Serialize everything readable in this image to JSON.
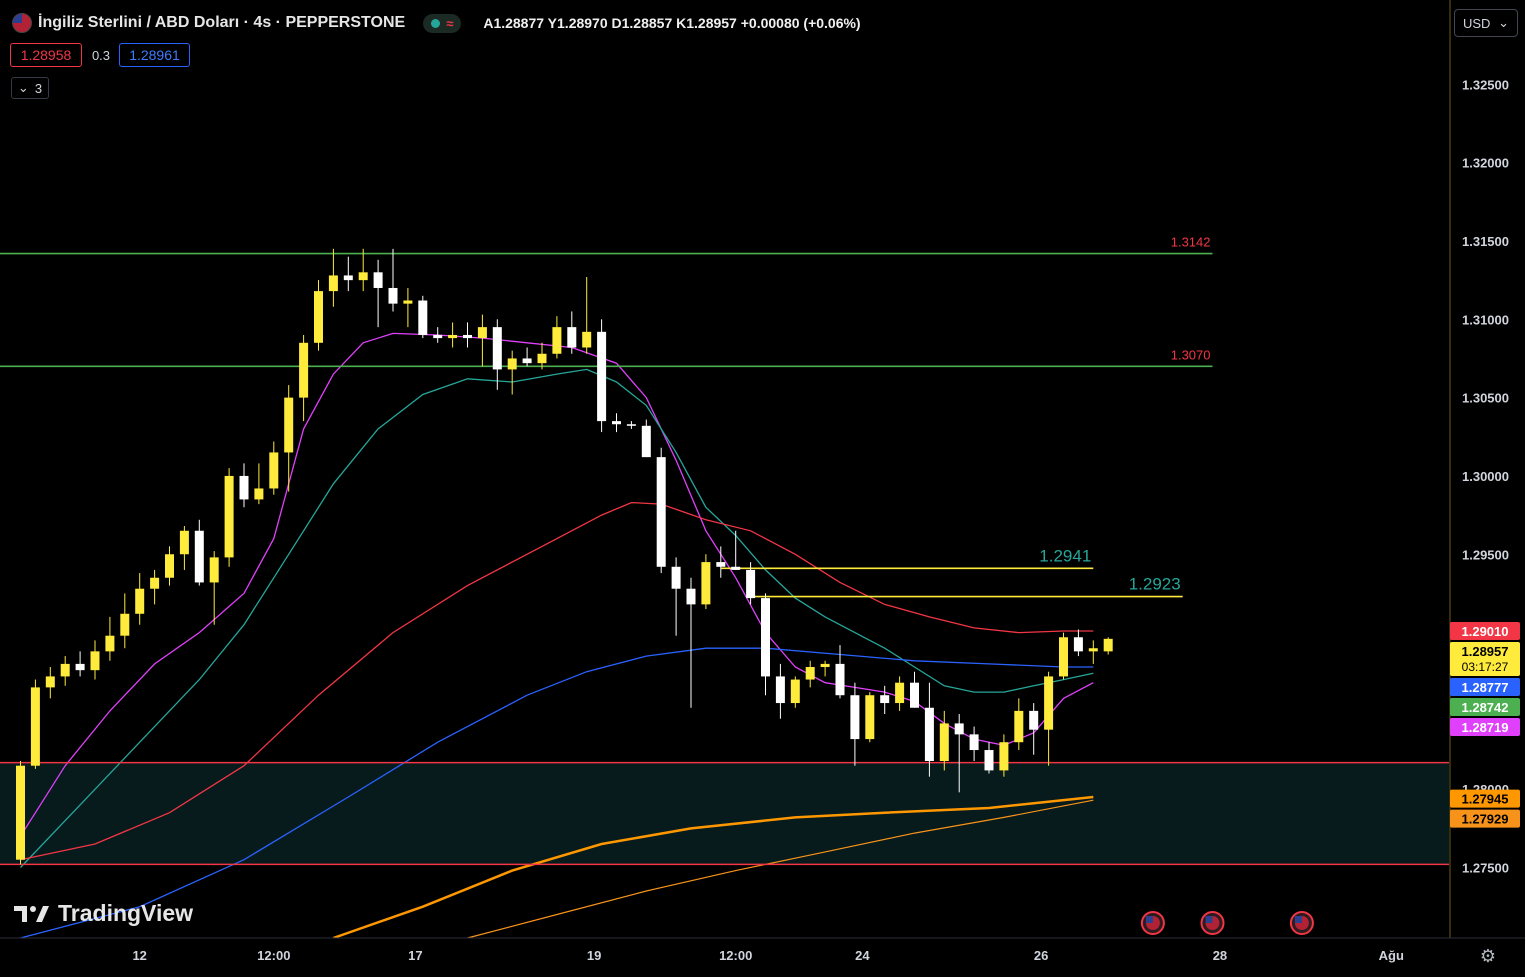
{
  "header": {
    "title": "İngiliz Sterlini / ABD Doları · 4s · PEPPERSTONE",
    "ohlc": "A1.28877  Y1.28970  D1.28857  K1.28957  +0.00080 (+0.06%)"
  },
  "trade": {
    "sell": "1.28958",
    "spread": "0.3",
    "buy": "1.28961"
  },
  "indicators_toggle": "3",
  "currency": "USD",
  "logo_text": "TradingView",
  "chart_data": {
    "type": "candlestick",
    "ylim": [
      1.2705,
      1.3293
    ],
    "x_tick_labels": [
      {
        "label": "12",
        "index": 8
      },
      {
        "label": "12:00",
        "index": 17
      },
      {
        "label": "17",
        "index": 26.5
      },
      {
        "label": "19",
        "index": 38.5
      },
      {
        "label": "12:00",
        "index": 48
      },
      {
        "label": "24",
        "index": 56.5
      },
      {
        "label": "26",
        "index": 68.5
      },
      {
        "label": "28",
        "index": 80.5
      },
      {
        "label": "Ağu",
        "index": 92
      }
    ],
    "y_tick_labels": [
      "1.32500",
      "1.32000",
      "1.31500",
      "1.31000",
      "1.30500",
      "1.30000",
      "1.29500",
      "1.28000",
      "1.27500"
    ],
    "candles": [
      {
        "o": 1.2755,
        "h": 1.2818,
        "l": 1.2752,
        "c": 1.2815
      },
      {
        "o": 1.2815,
        "h": 1.287,
        "l": 1.2813,
        "c": 1.2865
      },
      {
        "o": 1.2865,
        "h": 1.2878,
        "l": 1.2858,
        "c": 1.2872
      },
      {
        "o": 1.2872,
        "h": 1.2885,
        "l": 1.2866,
        "c": 1.288
      },
      {
        "o": 1.288,
        "h": 1.2888,
        "l": 1.2872,
        "c": 1.2876
      },
      {
        "o": 1.2876,
        "h": 1.2895,
        "l": 1.287,
        "c": 1.2888
      },
      {
        "o": 1.2888,
        "h": 1.291,
        "l": 1.2882,
        "c": 1.2898
      },
      {
        "o": 1.2898,
        "h": 1.2925,
        "l": 1.289,
        "c": 1.2912
      },
      {
        "o": 1.2912,
        "h": 1.2938,
        "l": 1.2905,
        "c": 1.2928
      },
      {
        "o": 1.2928,
        "h": 1.294,
        "l": 1.2918,
        "c": 1.2935
      },
      {
        "o": 1.2935,
        "h": 1.2955,
        "l": 1.293,
        "c": 1.295
      },
      {
        "o": 1.295,
        "h": 1.2968,
        "l": 1.294,
        "c": 1.2965
      },
      {
        "o": 1.2965,
        "h": 1.2972,
        "l": 1.293,
        "c": 1.2932
      },
      {
        "o": 1.2932,
        "h": 1.2952,
        "l": 1.2905,
        "c": 1.2948
      },
      {
        "o": 1.2948,
        "h": 1.3005,
        "l": 1.2942,
        "c": 1.3
      },
      {
        "o": 1.3,
        "h": 1.3008,
        "l": 1.298,
        "c": 1.2985
      },
      {
        "o": 1.2985,
        "h": 1.3008,
        "l": 1.2982,
        "c": 1.2992
      },
      {
        "o": 1.2992,
        "h": 1.3022,
        "l": 1.2988,
        "c": 1.3015
      },
      {
        "o": 1.3015,
        "h": 1.3058,
        "l": 1.299,
        "c": 1.305
      },
      {
        "o": 1.305,
        "h": 1.309,
        "l": 1.3035,
        "c": 1.3085
      },
      {
        "o": 1.3085,
        "h": 1.3125,
        "l": 1.308,
        "c": 1.3118
      },
      {
        "o": 1.3118,
        "h": 1.3145,
        "l": 1.3108,
        "c": 1.3128
      },
      {
        "o": 1.3128,
        "h": 1.314,
        "l": 1.3118,
        "c": 1.3125
      },
      {
        "o": 1.3125,
        "h": 1.3145,
        "l": 1.3118,
        "c": 1.313
      },
      {
        "o": 1.313,
        "h": 1.3138,
        "l": 1.3095,
        "c": 1.312
      },
      {
        "o": 1.312,
        "h": 1.3145,
        "l": 1.3105,
        "c": 1.311
      },
      {
        "o": 1.311,
        "h": 1.312,
        "l": 1.3095,
        "c": 1.3112
      },
      {
        "o": 1.3112,
        "h": 1.3115,
        "l": 1.3088,
        "c": 1.309
      },
      {
        "o": 1.309,
        "h": 1.3095,
        "l": 1.3085,
        "c": 1.3088
      },
      {
        "o": 1.3088,
        "h": 1.3098,
        "l": 1.3082,
        "c": 1.309
      },
      {
        "o": 1.309,
        "h": 1.3098,
        "l": 1.3082,
        "c": 1.3088
      },
      {
        "o": 1.3088,
        "h": 1.3103,
        "l": 1.307,
        "c": 1.3095
      },
      {
        "o": 1.3095,
        "h": 1.31,
        "l": 1.3055,
        "c": 1.3068
      },
      {
        "o": 1.3068,
        "h": 1.308,
        "l": 1.3052,
        "c": 1.3075
      },
      {
        "o": 1.3075,
        "h": 1.3082,
        "l": 1.307,
        "c": 1.3072
      },
      {
        "o": 1.3072,
        "h": 1.3085,
        "l": 1.3068,
        "c": 1.3078
      },
      {
        "o": 1.3078,
        "h": 1.3102,
        "l": 1.3075,
        "c": 1.3095
      },
      {
        "o": 1.3095,
        "h": 1.3105,
        "l": 1.3078,
        "c": 1.3082
      },
      {
        "o": 1.3082,
        "h": 1.3127,
        "l": 1.3078,
        "c": 1.3092
      },
      {
        "o": 1.3092,
        "h": 1.31,
        "l": 1.3028,
        "c": 1.3035
      },
      {
        "o": 1.3035,
        "h": 1.304,
        "l": 1.3028,
        "c": 1.3033
      },
      {
        "o": 1.3033,
        "h": 1.3035,
        "l": 1.303,
        "c": 1.3032
      },
      {
        "o": 1.3032,
        "h": 1.3036,
        "l": 1.302,
        "c": 1.3012
      },
      {
        "o": 1.3012,
        "h": 1.3018,
        "l": 1.2938,
        "c": 1.2942
      },
      {
        "o": 1.2942,
        "h": 1.2948,
        "l": 1.2898,
        "c": 1.2928
      },
      {
        "o": 1.2928,
        "h": 1.2935,
        "l": 1.2852,
        "c": 1.2918
      },
      {
        "o": 1.2918,
        "h": 1.295,
        "l": 1.2915,
        "c": 1.2945
      },
      {
        "o": 1.2945,
        "h": 1.2955,
        "l": 1.2935,
        "c": 1.2942
      },
      {
        "o": 1.2942,
        "h": 1.2965,
        "l": 1.294,
        "c": 1.294
      },
      {
        "o": 1.294,
        "h": 1.2945,
        "l": 1.2918,
        "c": 1.2922
      },
      {
        "o": 1.2922,
        "h": 1.2925,
        "l": 1.286,
        "c": 1.2872
      },
      {
        "o": 1.2872,
        "h": 1.288,
        "l": 1.2845,
        "c": 1.2855
      },
      {
        "o": 1.2855,
        "h": 1.2872,
        "l": 1.2852,
        "c": 1.287
      },
      {
        "o": 1.287,
        "h": 1.2882,
        "l": 1.2865,
        "c": 1.2878
      },
      {
        "o": 1.2878,
        "h": 1.2882,
        "l": 1.2872,
        "c": 1.288
      },
      {
        "o": 1.288,
        "h": 1.2892,
        "l": 1.2858,
        "c": 1.286
      },
      {
        "o": 1.286,
        "h": 1.2868,
        "l": 1.2815,
        "c": 1.2832
      },
      {
        "o": 1.2832,
        "h": 1.2862,
        "l": 1.283,
        "c": 1.286
      },
      {
        "o": 1.286,
        "h": 1.2866,
        "l": 1.2848,
        "c": 1.2855
      },
      {
        "o": 1.2855,
        "h": 1.2872,
        "l": 1.285,
        "c": 1.2868
      },
      {
        "o": 1.2868,
        "h": 1.2875,
        "l": 1.2852,
        "c": 1.2852
      },
      {
        "o": 1.2852,
        "h": 1.2868,
        "l": 1.2808,
        "c": 1.2818
      },
      {
        "o": 1.2818,
        "h": 1.285,
        "l": 1.2812,
        "c": 1.2842
      },
      {
        "o": 1.2842,
        "h": 1.2848,
        "l": 1.2798,
        "c": 1.2835
      },
      {
        "o": 1.2835,
        "h": 1.284,
        "l": 1.2818,
        "c": 1.2825
      },
      {
        "o": 1.2825,
        "h": 1.283,
        "l": 1.281,
        "c": 1.2812
      },
      {
        "o": 1.2812,
        "h": 1.2835,
        "l": 1.2808,
        "c": 1.283
      },
      {
        "o": 1.283,
        "h": 1.2858,
        "l": 1.2825,
        "c": 1.285
      },
      {
        "o": 1.285,
        "h": 1.2855,
        "l": 1.2822,
        "c": 1.2838
      },
      {
        "o": 1.2838,
        "h": 1.2875,
        "l": 1.2815,
        "c": 1.2872
      },
      {
        "o": 1.2872,
        "h": 1.29,
        "l": 1.287,
        "c": 1.2897
      },
      {
        "o": 1.2897,
        "h": 1.2902,
        "l": 1.2885,
        "c": 1.2888
      },
      {
        "o": 1.2888,
        "h": 1.2895,
        "l": 1.288,
        "c": 1.289
      },
      {
        "o": 1.2888,
        "h": 1.2897,
        "l": 1.2886,
        "c": 1.2896
      }
    ],
    "ma_lines": [
      {
        "color": "#e040fb",
        "points": [
          [
            0,
            1.277
          ],
          [
            3,
            1.2815
          ],
          [
            6,
            1.285
          ],
          [
            9,
            1.288
          ],
          [
            12,
            1.29
          ],
          [
            15,
            1.2925
          ],
          [
            17,
            1.296
          ],
          [
            19,
            1.303
          ],
          [
            21,
            1.3065
          ],
          [
            23,
            1.3085
          ],
          [
            25,
            1.3091
          ],
          [
            28,
            1.309
          ],
          [
            31,
            1.3088
          ],
          [
            34,
            1.3085
          ],
          [
            37,
            1.3082
          ],
          [
            40,
            1.3072
          ],
          [
            42,
            1.305
          ],
          [
            44,
            1.301
          ],
          [
            46,
            1.2965
          ],
          [
            48,
            1.2935
          ],
          [
            50,
            1.29
          ],
          [
            52,
            1.2878
          ],
          [
            54,
            1.2868
          ],
          [
            56,
            1.2865
          ],
          [
            58,
            1.2862
          ],
          [
            60,
            1.2856
          ],
          [
            62,
            1.2842
          ],
          [
            64,
            1.2832
          ],
          [
            66,
            1.2828
          ],
          [
            68,
            1.2836
          ],
          [
            70,
            1.2858
          ],
          [
            72,
            1.2868
          ]
        ]
      },
      {
        "color": "#26a69a",
        "points": [
          [
            0,
            1.275
          ],
          [
            4,
            1.279
          ],
          [
            8,
            1.283
          ],
          [
            12,
            1.287
          ],
          [
            15,
            1.2905
          ],
          [
            18,
            1.295
          ],
          [
            21,
            1.2995
          ],
          [
            24,
            1.303
          ],
          [
            27,
            1.3052
          ],
          [
            30,
            1.3062
          ],
          [
            33,
            1.306
          ],
          [
            36,
            1.3065
          ],
          [
            38,
            1.3068
          ],
          [
            40,
            1.306
          ],
          [
            42,
            1.3045
          ],
          [
            44,
            1.3015
          ],
          [
            46,
            1.298
          ],
          [
            48,
            1.2962
          ],
          [
            50,
            1.294
          ],
          [
            52,
            1.2922
          ],
          [
            54,
            1.291
          ],
          [
            56,
            1.29
          ],
          [
            58,
            1.289
          ],
          [
            60,
            1.2878
          ],
          [
            62,
            1.2866
          ],
          [
            64,
            1.2862
          ],
          [
            66,
            1.2862
          ],
          [
            68,
            1.2866
          ],
          [
            70,
            1.287
          ],
          [
            72,
            1.2874
          ]
        ]
      },
      {
        "color": "#f23645",
        "points": [
          [
            0,
            1.2755
          ],
          [
            5,
            1.2765
          ],
          [
            10,
            1.2785
          ],
          [
            15,
            1.2815
          ],
          [
            20,
            1.286
          ],
          [
            25,
            1.29
          ],
          [
            30,
            1.293
          ],
          [
            35,
            1.2955
          ],
          [
            39,
            1.2975
          ],
          [
            41,
            1.2983
          ],
          [
            43,
            1.2982
          ],
          [
            46,
            1.2972
          ],
          [
            49,
            1.2965
          ],
          [
            52,
            1.295
          ],
          [
            55,
            1.2932
          ],
          [
            58,
            1.2918
          ],
          [
            61,
            1.291
          ],
          [
            64,
            1.2903
          ],
          [
            67,
            1.29
          ],
          [
            70,
            1.2901
          ],
          [
            72,
            1.2901
          ]
        ]
      },
      {
        "color": "#2962ff",
        "points": [
          [
            0,
            1.2705
          ],
          [
            8,
            1.2725
          ],
          [
            15,
            1.2755
          ],
          [
            22,
            1.2795
          ],
          [
            28,
            1.283
          ],
          [
            34,
            1.286
          ],
          [
            38,
            1.2875
          ],
          [
            42,
            1.2885
          ],
          [
            46,
            1.289
          ],
          [
            50,
            1.289
          ],
          [
            55,
            1.2886
          ],
          [
            60,
            1.2882
          ],
          [
            65,
            1.288
          ],
          [
            70,
            1.2878
          ],
          [
            72,
            1.2878
          ]
        ]
      },
      {
        "color": "#ff9800",
        "width": 2.5,
        "points": [
          [
            21,
            1.2705
          ],
          [
            27,
            1.2725
          ],
          [
            33,
            1.2748
          ],
          [
            39,
            1.2765
          ],
          [
            45,
            1.2775
          ],
          [
            52,
            1.2782
          ],
          [
            58,
            1.2785
          ],
          [
            65,
            1.2788
          ],
          [
            72,
            1.2795
          ]
        ]
      },
      {
        "color": "#f7931a",
        "width": 1.2,
        "points": [
          [
            30,
            1.2705
          ],
          [
            36,
            1.272
          ],
          [
            42,
            1.2735
          ],
          [
            48,
            1.2748
          ],
          [
            54,
            1.276
          ],
          [
            60,
            1.2772
          ],
          [
            66,
            1.2782
          ],
          [
            72,
            1.2793
          ]
        ]
      }
    ],
    "hlines": [
      {
        "y": 1.3142,
        "x0": -2,
        "x1": 80,
        "color": "#4caf50",
        "label": "1.3142",
        "labelColor": "#f23645",
        "labelSize": 13
      },
      {
        "y": 1.307,
        "x0": -2,
        "x1": 80,
        "color": "#4caf50",
        "label": "1.3070",
        "labelColor": "#f23645",
        "labelSize": 13
      },
      {
        "y": 1.2941,
        "x0": 47,
        "x1": 72,
        "color": "#ffeb3b",
        "label": "1.2941",
        "labelColor": "#26a69a",
        "labelSize": 17
      },
      {
        "y": 1.2923,
        "x0": 49,
        "x1": 78,
        "color": "#ffeb3b",
        "label": "1.2923",
        "labelColor": "#26a69a",
        "labelSize": 17
      }
    ],
    "zone": {
      "top": 1.2817,
      "bottom": 1.2752,
      "fill": "#071a1c",
      "lineColor": "#f23645"
    },
    "price_labels": [
      {
        "text": "1.29010",
        "bg": "#f23645",
        "fg": "#ffffff",
        "y": 1.2901
      },
      {
        "text": "1.28957",
        "sub": "03:17:27",
        "bg": "#ffeb3b",
        "fg": "#000000",
        "y": 1.2896
      },
      {
        "text": "1.28777",
        "bg": "#2962ff",
        "fg": "#ffffff",
        "y": 1.2878
      },
      {
        "text": "1.28742",
        "bg": "#4caf50",
        "fg": "#ffffff",
        "y": 1.2874
      },
      {
        "text": "1.28719",
        "bg": "#e040fb",
        "fg": "#ffffff",
        "y": 1.2872
      },
      {
        "text": "1.27945",
        "bg": "#ff9800",
        "fg": "#000000",
        "y": 1.2794
      },
      {
        "text": "1.27929",
        "bg": "#f7931a",
        "fg": "#000000",
        "y": 1.2793
      }
    ],
    "events": [
      {
        "index": 76
      },
      {
        "index": 80
      },
      {
        "index": 86
      }
    ]
  }
}
